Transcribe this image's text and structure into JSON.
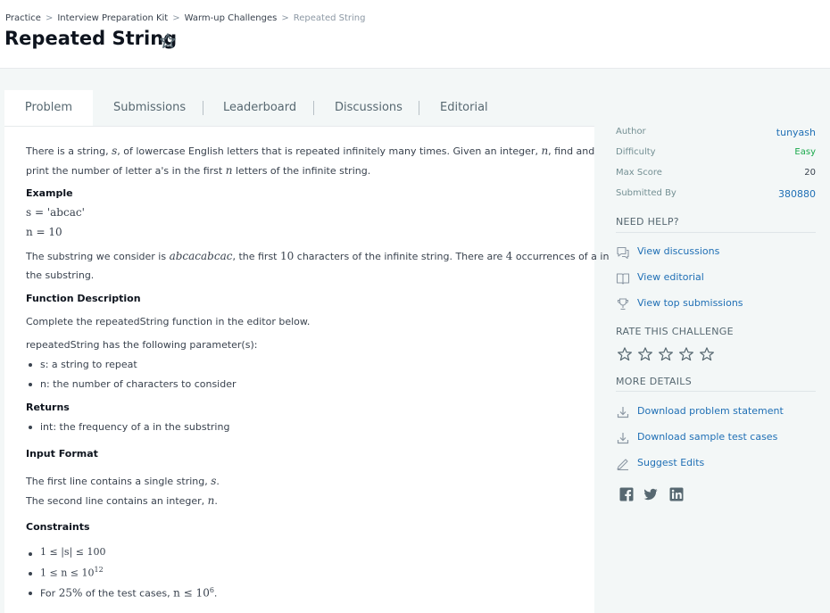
{
  "breadcrumb": {
    "items": [
      "Practice",
      "Interview Preparation Kit",
      "Warm-up Challenges"
    ],
    "current": "Repeated String",
    "separator": ">"
  },
  "title": "Repeated String",
  "tabs": [
    "Problem",
    "Submissions",
    "Leaderboard",
    "Discussions",
    "Editorial"
  ],
  "problem": {
    "intro_1a": "There is a string, ",
    "var_s": "s",
    "intro_1b": ", of lowercase English letters that is repeated infinitely many times. Given an integer, ",
    "var_n": "n",
    "intro_1c": ", find and",
    "intro_2a": "print the number of letter a's in the first ",
    "intro_2b": " letters of the infinite string.",
    "example_heading": "Example",
    "example_s": "s = 'abcac'",
    "example_n": "n = 10",
    "substr_a": "The substring we consider is ",
    "substr_word": "abcacabcac",
    "substr_b": ", the first ",
    "substr_ten": "10",
    "substr_c": " characters of the infinite string. There are ",
    "substr_four": "4",
    "substr_d": " occurrences of a in",
    "substr_2": "the substring.",
    "func_heading": "Function Description",
    "func_text": "Complete the repeatedString function in the editor below.",
    "params_intro": "repeatedString has the following parameter(s):",
    "params": [
      "s: a string to repeat",
      "n: the number of characters to consider"
    ],
    "returns_heading": "Returns",
    "returns": [
      "int: the frequency of a in the substring"
    ],
    "input_heading": "Input Format",
    "input_1a": "The first line contains a single string, ",
    "input_1b": ".",
    "input_2a": "The second line contains an integer, ",
    "input_2b": ".",
    "constraints_heading": "Constraints",
    "constraint_1": "1 ≤ |s| ≤ 100",
    "constraint_2a": "1 ≤ n ≤ 10",
    "constraint_2b": "12",
    "constraint_3a": "For ",
    "constraint_3b": "25%",
    "constraint_3c": " of the test cases, ",
    "constraint_3d": "n ≤ 10",
    "constraint_3e": "6",
    "constraint_3f": "."
  },
  "sidebar": {
    "author_label": "Author",
    "author": "tunyash",
    "difficulty_label": "Difficulty",
    "difficulty": "Easy",
    "max_score_label": "Max Score",
    "max_score": "20",
    "submitted_label": "Submitted By",
    "submitted": "380880",
    "need_help": "NEED HELP?",
    "help_links": [
      "View discussions",
      "View editorial",
      "View top submissions"
    ],
    "rate": "RATE THIS CHALLENGE",
    "rating_stars": 5,
    "more_details": "MORE DETAILS",
    "detail_links": [
      "Download problem statement",
      "Download sample test cases",
      "Suggest Edits"
    ]
  },
  "colors": {
    "link": "#1f6fb5",
    "easy": "#1ba94c",
    "icon": "#8c98a4",
    "social": "#576871"
  }
}
